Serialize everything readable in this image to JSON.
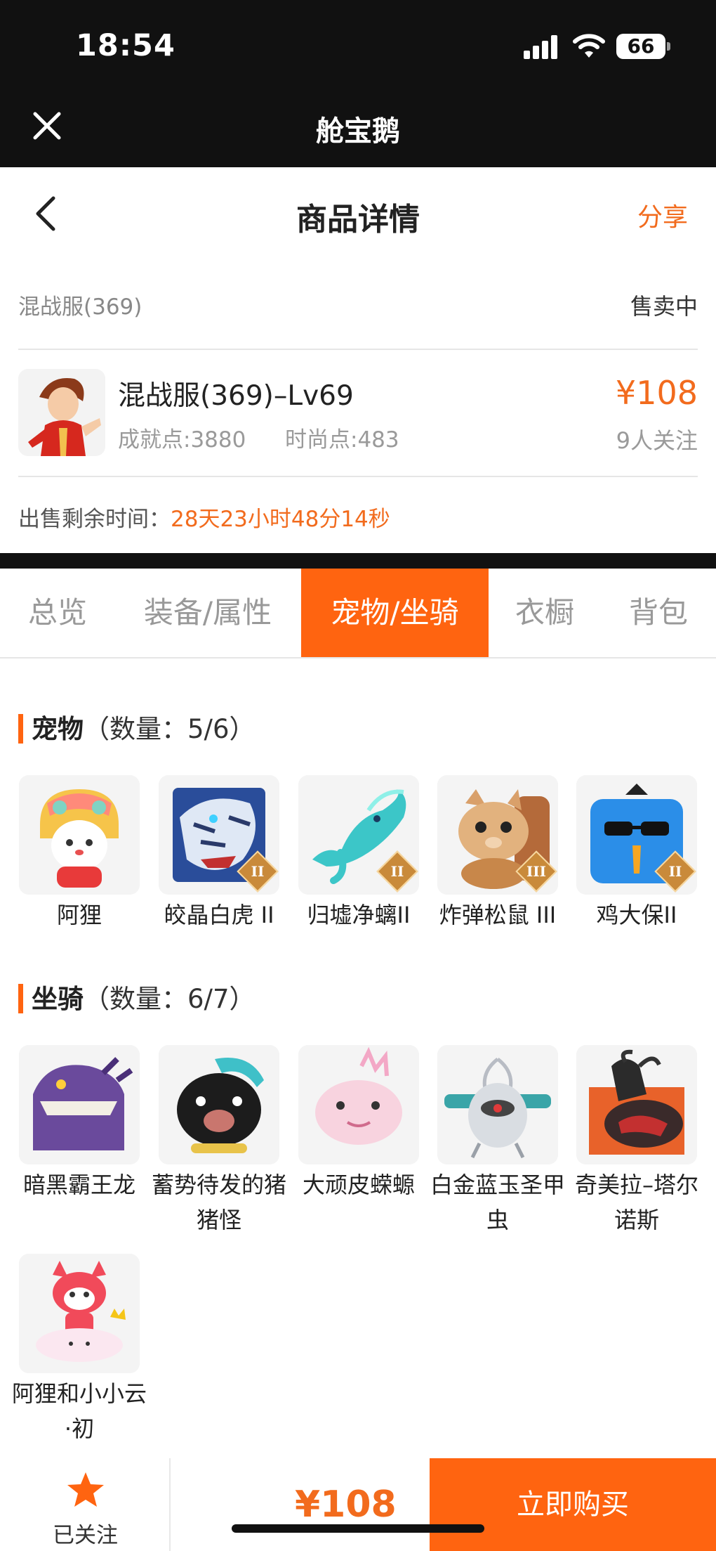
{
  "status_bar": {
    "time": "18:54",
    "battery": "66"
  },
  "app_bar": {
    "title": "舱宝鹅"
  },
  "header": {
    "title": "商品详情",
    "share_label": "分享"
  },
  "listing": {
    "server": "混战服(369)",
    "status": "售卖中",
    "character_title": "混战服(369)–Lv69",
    "achievement": "成就点:3880",
    "fashion": "时尚点:483",
    "price": "¥108",
    "followers": "9人关注",
    "timer_label": "出售剩余时间：",
    "timer_value": "28天23小时48分14秒"
  },
  "tabs": [
    {
      "label": "总览",
      "active": false
    },
    {
      "label": "装备/属性",
      "active": false
    },
    {
      "label": "宠物/坐骑",
      "active": true
    },
    {
      "label": "衣橱",
      "active": false
    },
    {
      "label": "背包",
      "active": false
    }
  ],
  "pets": {
    "title": "宠物",
    "count": "（数量：5/6）",
    "items": [
      {
        "name": "阿狸",
        "icon": "fox-lion-pet",
        "badge": ""
      },
      {
        "name": "皎晶白虎 II",
        "icon": "white-tiger-pet",
        "badge": "II"
      },
      {
        "name": "归墟净螭II",
        "icon": "cyan-dragon-pet",
        "badge": "II"
      },
      {
        "name": "炸弹松鼠 III",
        "icon": "squirrel-pet",
        "badge": "III"
      },
      {
        "name": "鸡大保II",
        "icon": "blue-chicken-pet",
        "badge": "II"
      }
    ]
  },
  "mounts": {
    "title": "坐骑",
    "count": "（数量：6/7）",
    "items": [
      {
        "name": "暗黑霸王龙",
        "icon": "purple-trex-mount"
      },
      {
        "name": "蓄势待发的猪猪怪",
        "icon": "black-pig-mount"
      },
      {
        "name": "大顽皮蝾螈",
        "icon": "pink-axolotl-mount"
      },
      {
        "name": "白金蓝玉圣甲虫",
        "icon": "scarab-mount"
      },
      {
        "name": "奇美拉–塔尔诺斯",
        "icon": "chimera-mount"
      },
      {
        "name": "阿狸和小小云·初",
        "icon": "fox-cloud-mount"
      }
    ]
  },
  "bottom_bar": {
    "follow_label": "已关注",
    "price": "¥108",
    "buy_label": "立即购买"
  },
  "colors": {
    "accent": "#ff6410",
    "price": "#f26b1d",
    "topbar": "#111111"
  }
}
